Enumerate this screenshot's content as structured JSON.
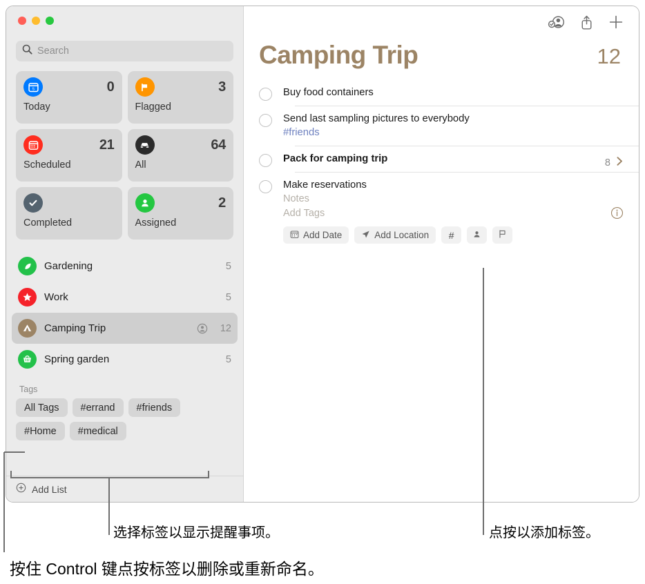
{
  "window": {
    "traffic_lights": [
      "close",
      "minimize",
      "zoom"
    ]
  },
  "sidebar": {
    "search": {
      "placeholder": "Search",
      "value": ""
    },
    "smart_lists": [
      {
        "label": "Today",
        "count": "0",
        "icon": "calendar-today-icon",
        "color": "#007aff"
      },
      {
        "label": "Flagged",
        "count": "3",
        "icon": "flag-icon",
        "color": "#ff9500"
      },
      {
        "label": "Scheduled",
        "count": "21",
        "icon": "calendar-icon",
        "color": "#ff2d1f"
      },
      {
        "label": "All",
        "count": "64",
        "icon": "tray-icon",
        "color": "#2b2b2b"
      },
      {
        "label": "Completed",
        "count": "",
        "icon": "checkmark-icon",
        "color": "#54636f"
      },
      {
        "label": "Assigned",
        "count": "2",
        "icon": "person-icon",
        "color": "#24c741"
      }
    ],
    "lists": [
      {
        "name": "Gardening",
        "count": "5",
        "icon": "leaf-icon",
        "color": "#23c14a",
        "selected": false,
        "shared": false
      },
      {
        "name": "Work",
        "count": "5",
        "icon": "star-icon",
        "color": "#f5222a",
        "selected": false,
        "shared": false
      },
      {
        "name": "Camping Trip",
        "count": "12",
        "icon": "tent-icon",
        "color": "#9c8465",
        "selected": true,
        "shared": true
      },
      {
        "name": "Spring garden",
        "count": "5",
        "icon": "basket-icon",
        "color": "#23c14a",
        "selected": false,
        "shared": false
      }
    ],
    "tags_header": "Tags",
    "tags": [
      "All Tags",
      "#errand",
      "#friends",
      "#Home",
      "#medical"
    ],
    "add_list": {
      "label": "Add List",
      "icon": "plus-circle-icon"
    }
  },
  "main": {
    "toolbar": [
      {
        "name": "shared-person-icon",
        "label": "Share participants"
      },
      {
        "name": "share-icon",
        "label": "Share"
      },
      {
        "name": "plus-icon",
        "label": "New Reminder"
      }
    ],
    "title": "Camping Trip",
    "total": "12",
    "accent_color": "#9c8465",
    "reminders": [
      {
        "title": "Buy food containers",
        "bold": false,
        "tag": "",
        "notes": "",
        "add_tags": "",
        "count": "",
        "chevron": false,
        "info": false,
        "actions": []
      },
      {
        "title": "Send last sampling pictures to everybody",
        "bold": false,
        "tag": "#friends",
        "notes": "",
        "add_tags": "",
        "count": "",
        "chevron": false,
        "info": false,
        "actions": []
      },
      {
        "title": "Pack for camping trip",
        "bold": true,
        "tag": "",
        "notes": "",
        "add_tags": "",
        "count": "8",
        "chevron": true,
        "info": false,
        "actions": []
      },
      {
        "title": "Make reservations",
        "bold": false,
        "tag": "",
        "notes": "Notes",
        "add_tags": "Add Tags",
        "count": "",
        "chevron": false,
        "info": true,
        "actions": [
          {
            "label": "Add Date",
            "icon": "calendar-small-icon"
          },
          {
            "label": "Add Location",
            "icon": "location-arrow-icon"
          },
          {
            "label": "#",
            "icon": "hash-icon"
          },
          {
            "label": "",
            "icon": "person-small-icon"
          },
          {
            "label": "",
            "icon": "flag-outline-icon"
          }
        ]
      }
    ]
  },
  "callouts": {
    "tags_note": "选择标签以显示提醒事项。",
    "hash_note": "点按以添加标签。",
    "control_note": "按住 Control 键点按标签以删除或重新命名。"
  }
}
